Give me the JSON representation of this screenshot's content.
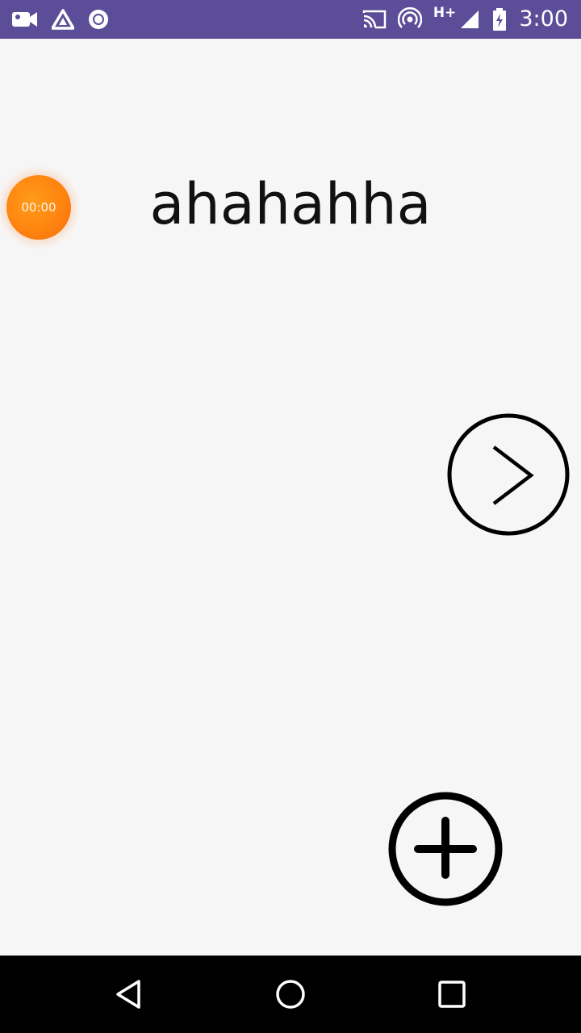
{
  "status_bar": {
    "background": "#5c4d98",
    "left_icons": [
      "videocam-icon",
      "drive-icon",
      "record-circle-icon"
    ],
    "right_icons": [
      "cast-icon",
      "hotspot-icon",
      "signal-icon",
      "battery-charging-icon"
    ],
    "network_type": "H+",
    "time": "3:00"
  },
  "main": {
    "timer": {
      "value": "00:00",
      "color": "#ff8410"
    },
    "headline": "ahahahha",
    "next_button_icon": "chevron-right-circle-icon",
    "add_button_icon": "add-circle-icon"
  },
  "nav_bar": {
    "background": "#000000",
    "buttons": [
      "back-icon",
      "home-icon",
      "recents-icon"
    ]
  }
}
